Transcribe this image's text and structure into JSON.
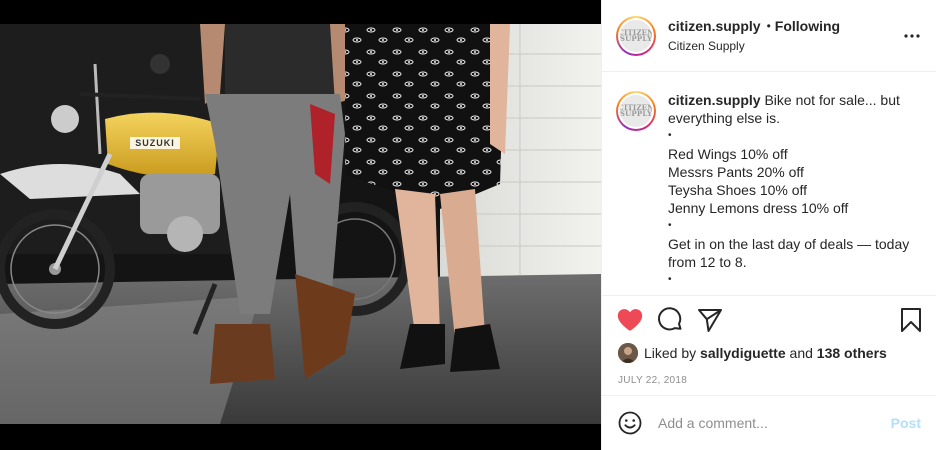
{
  "header": {
    "username": "citizen.supply",
    "separator": "•",
    "follow_status": "Following",
    "full_name": "Citizen Supply",
    "avatar_logo": "CITIZEN SUPPLY",
    "more_icon": "more-horizontal-icon"
  },
  "photo": {
    "motorcycle_brand": "SUZUKI"
  },
  "caption": {
    "username": "citizen.supply",
    "line1": "Bike not for sale... but",
    "line2": "everything else is.",
    "bullet": "•",
    "items": [
      "Red Wings 10% off",
      "Messrs Pants 20% off",
      "Teysha Shoes 10% off",
      "Jenny Lemons dress 10% off"
    ],
    "deal_line1": "Get in on the last day of deals — today",
    "deal_line2": "from 12 to 8."
  },
  "actions": {
    "like_icon": "heart-filled-icon",
    "comment_icon": "comment-icon",
    "share_icon": "send-icon",
    "save_icon": "bookmark-icon",
    "like_color": "#ed4956"
  },
  "likes": {
    "prefix": "Liked by",
    "user": "sallydiguette",
    "middle": "and",
    "others": "138 others"
  },
  "date": "JULY 22, 2018",
  "comment": {
    "placeholder": "Add a comment...",
    "post_label": "Post",
    "emoji_icon": "smiley-icon"
  }
}
